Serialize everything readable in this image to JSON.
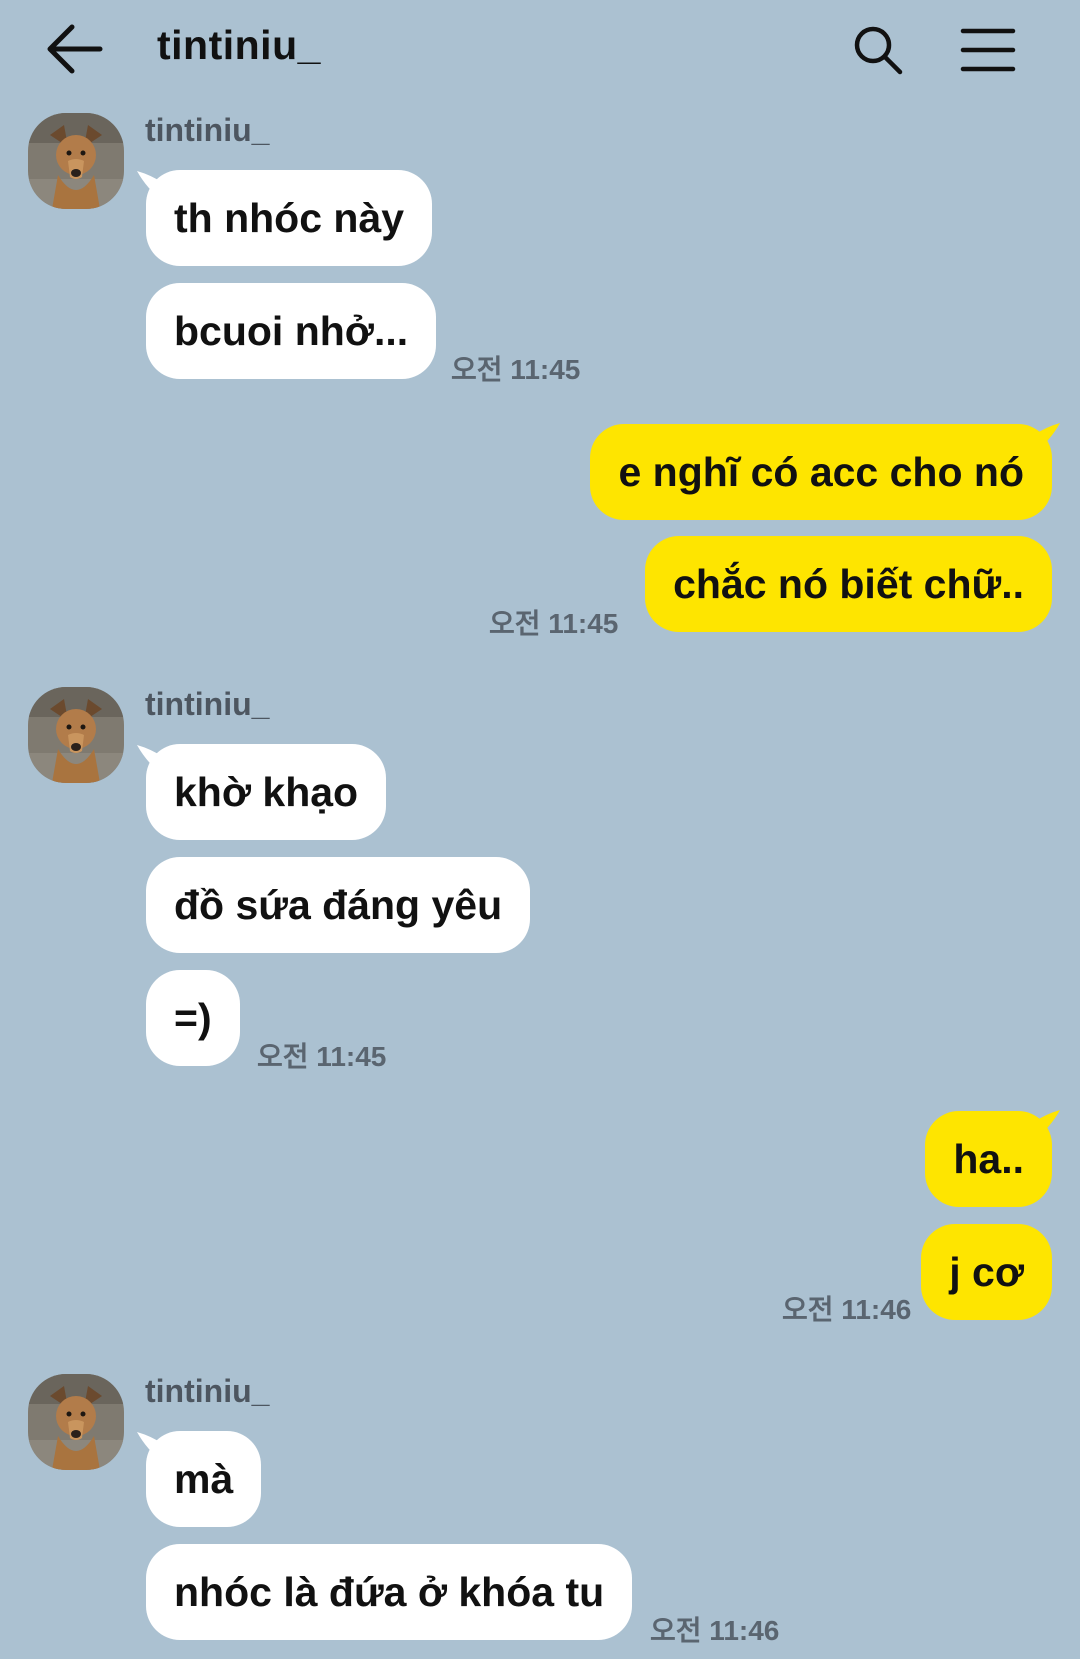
{
  "header": {
    "title": "tintiniu_"
  },
  "icons": {
    "back": "back-arrow-icon",
    "search": "search-icon",
    "menu": "menu-icon"
  },
  "colors": {
    "background": "#abc1d1",
    "incoming_bubble": "#ffffff",
    "outgoing_bubble": "#fee500"
  },
  "messages": {
    "g1": {
      "sender": "tintiniu_",
      "lines": [
        "th nhóc này",
        "bcuoi nhở..."
      ],
      "time": "오전 11:45"
    },
    "g2": {
      "lines": [
        "e nghĩ có acc cho nó",
        "chắc nó biết chữ.."
      ],
      "time": "오전 11:45"
    },
    "g3": {
      "sender": "tintiniu_",
      "lines": [
        "khờ khạo",
        "đồ sứa đáng yêu",
        "=)"
      ],
      "time": "오전 11:45"
    },
    "g4": {
      "lines": [
        "ha..",
        "j cơ"
      ],
      "time": "오전 11:46"
    },
    "g5": {
      "sender": "tintiniu_",
      "lines": [
        "mà",
        "nhóc là đứa ở khóa tu"
      ],
      "time": "오전 11:46"
    }
  }
}
